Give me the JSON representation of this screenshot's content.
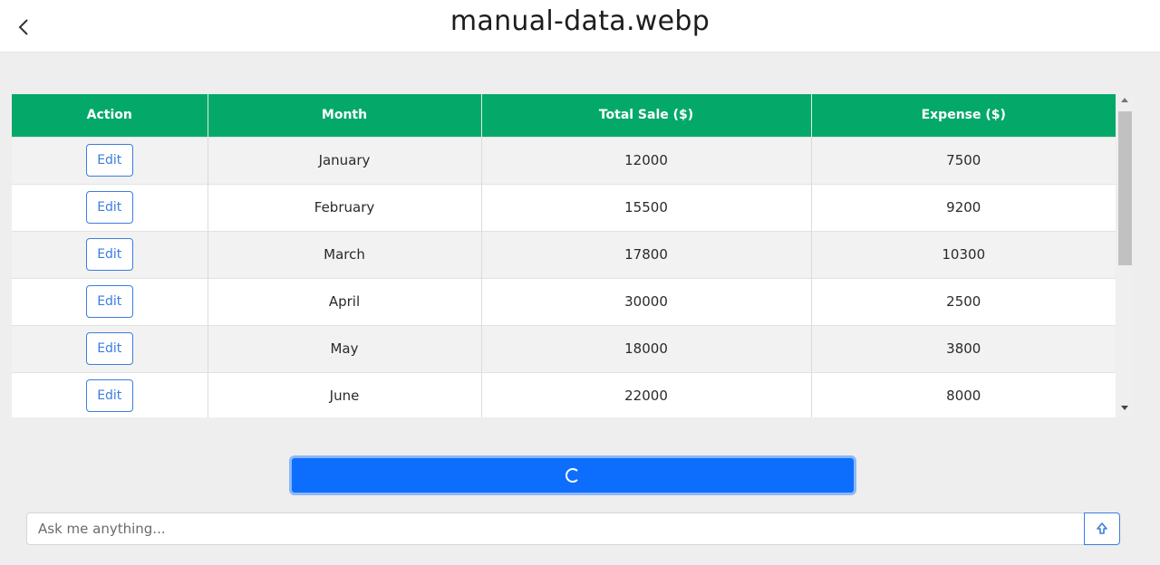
{
  "header": {
    "title": "manual-data.webp",
    "back_icon": "chevron-left-icon"
  },
  "table": {
    "columns": [
      "Action",
      "Month",
      "Total Sale ($)",
      "Expense ($)"
    ],
    "rows": [
      {
        "action": "Edit",
        "month": "January",
        "total_sale": "12000",
        "expense": "7500"
      },
      {
        "action": "Edit",
        "month": "February",
        "total_sale": "15500",
        "expense": "9200"
      },
      {
        "action": "Edit",
        "month": "March",
        "total_sale": "17800",
        "expense": "10300"
      },
      {
        "action": "Edit",
        "month": "April",
        "total_sale": "30000",
        "expense": "2500"
      },
      {
        "action": "Edit",
        "month": "May",
        "total_sale": "18000",
        "expense": "3800"
      },
      {
        "action": "Edit",
        "month": "June",
        "total_sale": "22000",
        "expense": "8000"
      }
    ]
  },
  "submit": {
    "state": "loading",
    "icon": "spinner-icon"
  },
  "chat": {
    "placeholder": "Ask me anything...",
    "send_icon": "arrow-up-icon"
  },
  "colors": {
    "header_accent": "#04a96a",
    "primary": "#0d6efd",
    "edit_button": "#3b7ddd"
  }
}
